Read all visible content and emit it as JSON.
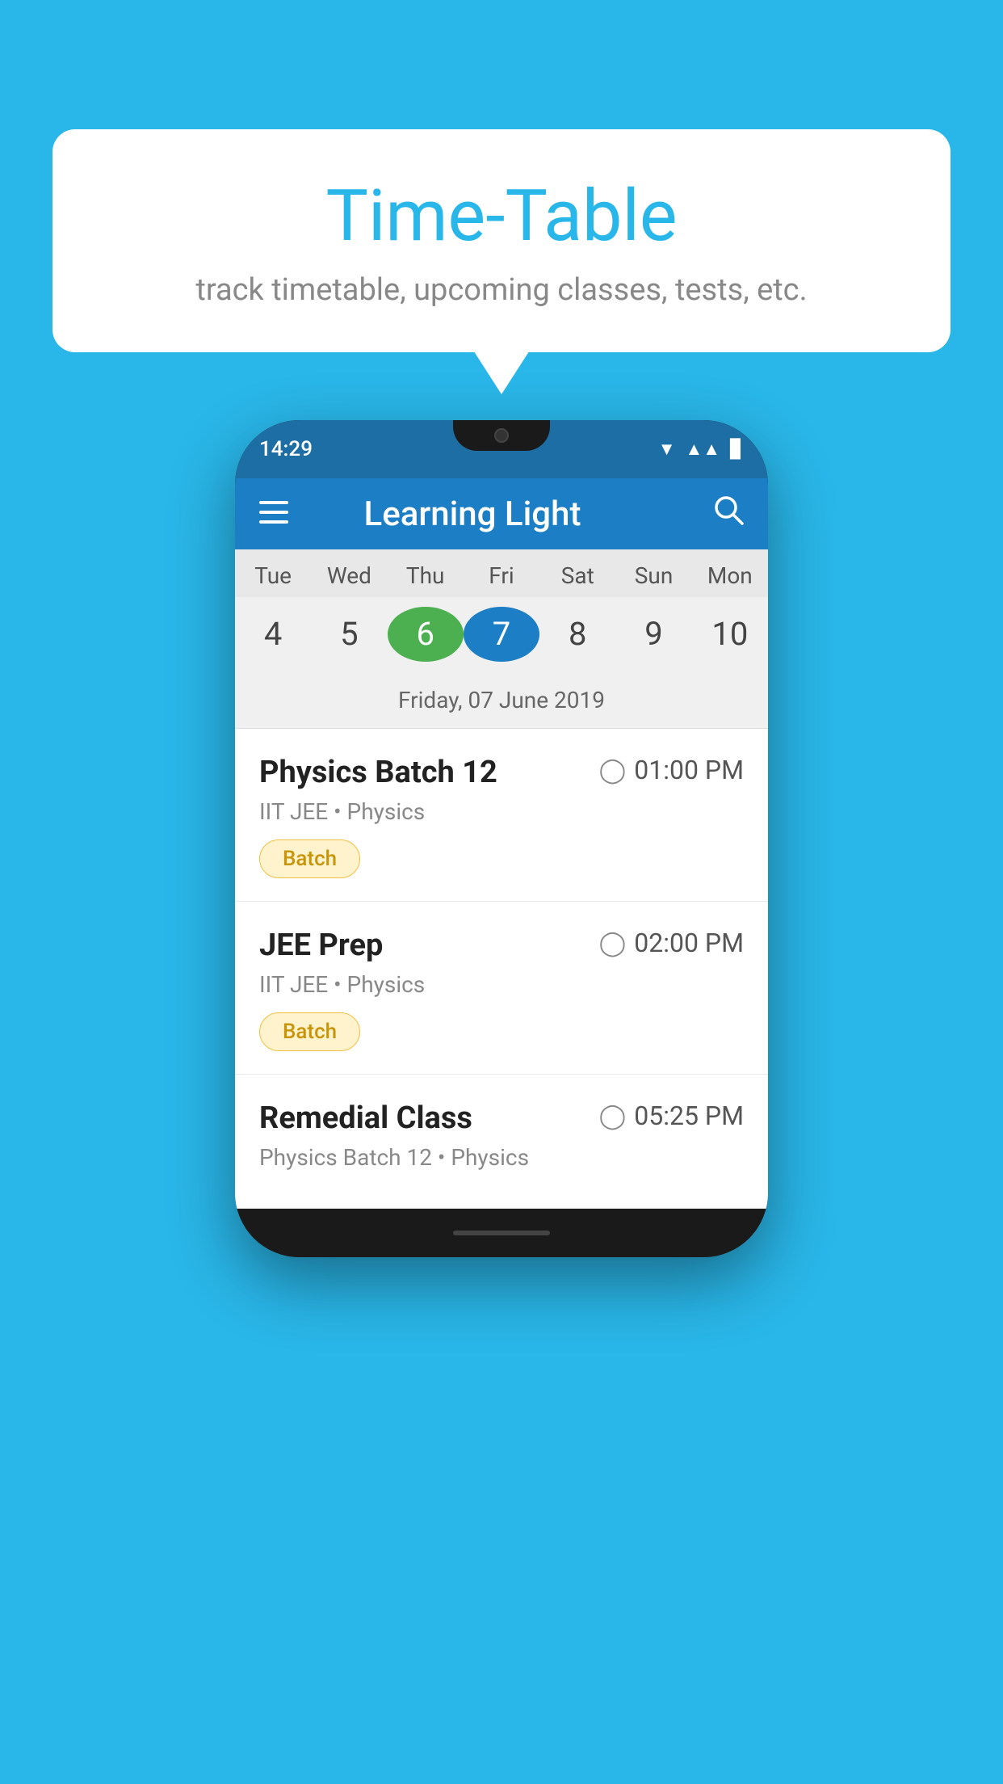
{
  "background_color": "#29b6e8",
  "bubble": {
    "title": "Time-Table",
    "subtitle": "track timetable, upcoming classes, tests, etc."
  },
  "phone": {
    "status_bar": {
      "time": "14:29"
    },
    "app_bar": {
      "title": "Learning Light"
    },
    "calendar": {
      "days": [
        {
          "label": "Tue",
          "num": "4"
        },
        {
          "label": "Wed",
          "num": "5"
        },
        {
          "label": "Thu",
          "num": "6",
          "state": "today"
        },
        {
          "label": "Fri",
          "num": "7",
          "state": "selected"
        },
        {
          "label": "Sat",
          "num": "8"
        },
        {
          "label": "Sun",
          "num": "9"
        },
        {
          "label": "Mon",
          "num": "10"
        }
      ],
      "selected_date": "Friday, 07 June 2019"
    },
    "schedule": [
      {
        "title": "Physics Batch 12",
        "time": "01:00 PM",
        "subtitle": "IIT JEE • Physics",
        "badge": "Batch"
      },
      {
        "title": "JEE Prep",
        "time": "02:00 PM",
        "subtitle": "IIT JEE • Physics",
        "badge": "Batch"
      },
      {
        "title": "Remedial Class",
        "time": "05:25 PM",
        "subtitle": "Physics Batch 12 • Physics",
        "badge": null
      }
    ]
  }
}
